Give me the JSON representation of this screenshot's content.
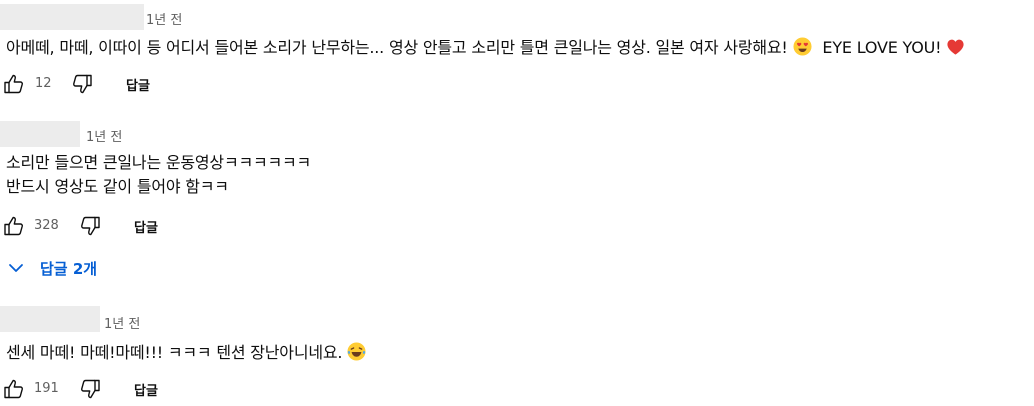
{
  "comments": [
    {
      "timestamp": "1년 전",
      "text_lines": [
        "아메떼, 마떼, 이따이 등 어디서 들어본 소리가 난무하는... 영상 안틀고 소리만 틀면 큰일나는 영상. 일본 여자 사랑해요!",
        "EYE LOVE YOU!"
      ],
      "likes": "12",
      "reply_label": "답글"
    },
    {
      "timestamp": "1년 전",
      "text_lines": [
        "소리만 들으면 큰일나는 운동영상ㅋㅋㅋㅋㅋㅋ",
        "반드시 영상도 같이 틀어야 함ㅋㅋ"
      ],
      "likes": "328",
      "reply_label": "답글",
      "replies_toggle": "답글 2개"
    },
    {
      "timestamp": "1년 전",
      "text_lines": [
        "센세 마떼! 마떼!마떼!!! ㅋㅋㅋ 텐션  장난아니네요."
      ],
      "likes": "191",
      "reply_label": "답글"
    }
  ],
  "icons": {
    "like": "thumb-up-icon",
    "dislike": "thumb-down-icon",
    "expand": "chevron-down-icon",
    "emoji_heart_eyes": "heart-eyes-emoji-icon",
    "emoji_heart": "red-heart-icon",
    "emoji_laugh": "laughing-tears-emoji-icon"
  },
  "colors": {
    "accent_blue": "#065fd4",
    "secondary_text": "#606060",
    "heart_red": "#e53935"
  }
}
